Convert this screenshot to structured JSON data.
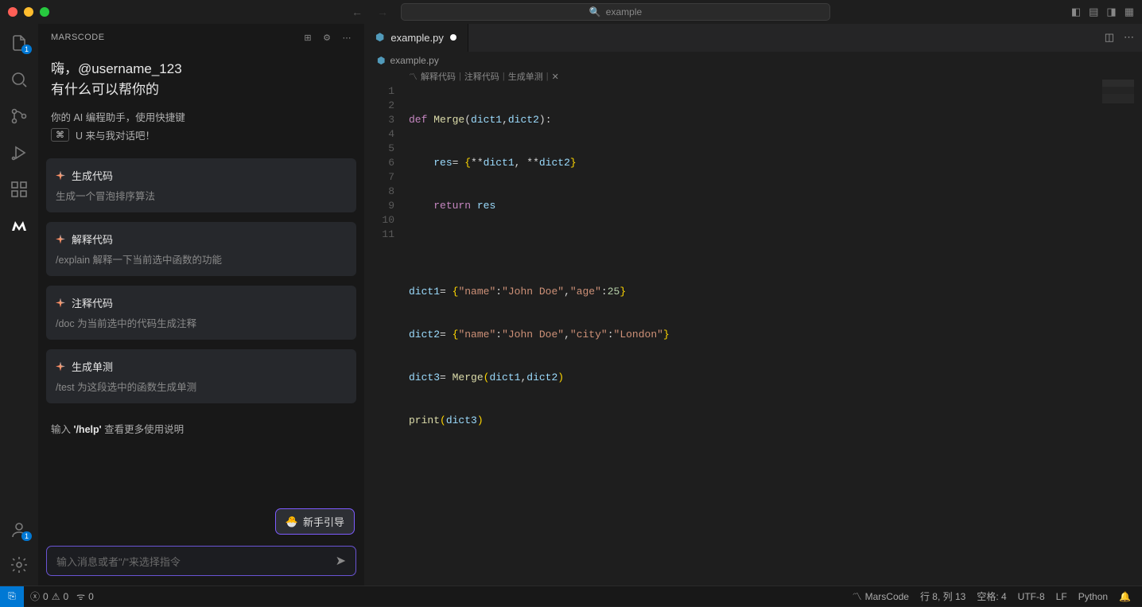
{
  "titlebar": {
    "search_text": "example"
  },
  "sidebar": {
    "title": "MARSCODE",
    "greeting_line1": "嗨，@username_123",
    "greeting_line2": "有什么可以帮你的",
    "subtitle": "你的 AI 编程助手，使用快捷键",
    "shortcut_key": "⌘",
    "shortcut_text": "U 来与我对话吧！",
    "help_hint_prefix": "输入 ",
    "help_hint_cmd": "'/help'",
    "help_hint_suffix": " 查看更多使用说明",
    "guide_button": "新手引导",
    "chat_placeholder": "输入消息或者\"/\"来选择指令",
    "cards": [
      {
        "title": "生成代码",
        "desc": "生成一个冒泡排序算法"
      },
      {
        "title": "解释代码",
        "desc": "/explain 解释一下当前选中函数的功能"
      },
      {
        "title": "注释代码",
        "desc": "/doc 为当前选中的代码生成注释"
      },
      {
        "title": "生成单测",
        "desc": "/test 为这段选中的函数生成单测"
      }
    ]
  },
  "activity": {
    "explorer_badge": "1",
    "account_badge": "1"
  },
  "editor": {
    "tab_name": "example.py",
    "breadcrumb": "example.py",
    "codelens": {
      "m": "解释代码",
      "a": "注释代码",
      "t": "生成单测"
    },
    "line_count": 11,
    "code": {
      "l1": {
        "def": "def",
        "name": "Merge",
        "args": "(dict1,dict2):"
      },
      "l2": {
        "indent": "    ",
        "var": "res",
        "eq": "= {**",
        "d1": "dict1",
        "mid": ", **",
        "d2": "dict2",
        "end": "}"
      },
      "l3": {
        "indent": "    ",
        "ret": "return",
        "v": "res"
      },
      "l5": {
        "v": "dict1",
        "eq": "= {",
        "k1": "\"name\"",
        "c": ":",
        "v1": "\"John Doe\"",
        "cm": ",",
        "k2": "\"age\"",
        "v2": "25",
        "end": "}"
      },
      "l6": {
        "v": "dict2",
        "eq": "= {",
        "k1": "\"name\"",
        "v1": "\"John Doe\"",
        "k2": "\"city\"",
        "v2": "\"London\"",
        "end": "}"
      },
      "l7": {
        "v": "dict3",
        "eq": "= ",
        "fn": "Merge",
        "args": "(dict1,dict2)"
      },
      "l8": {
        "fn": "print",
        "args": "(dict3)"
      }
    }
  },
  "statusbar": {
    "errors": "0",
    "warnings": "0",
    "ports": "0",
    "marscode": "MarsCode",
    "cursor": "行 8, 列 13",
    "spaces": "空格: 4",
    "encoding": "UTF-8",
    "eol": "LF",
    "lang": "Python"
  }
}
